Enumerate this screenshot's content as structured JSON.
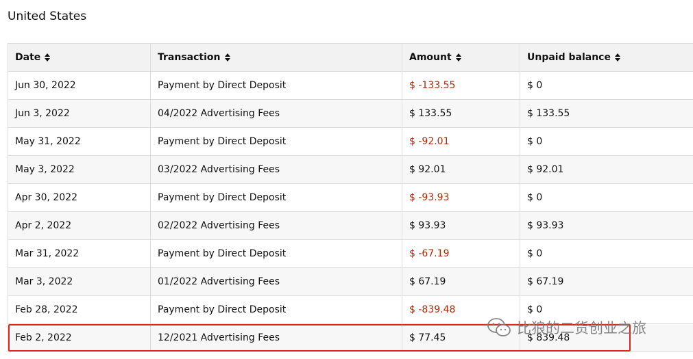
{
  "region_title": "United States",
  "columns": [
    "Date",
    "Transaction",
    "Amount",
    "Unpaid balance"
  ],
  "rows": [
    {
      "date": "Jun 30, 2022",
      "transaction": "Payment by Direct Deposit",
      "amount": "$ -133.55",
      "balance": "$ 0"
    },
    {
      "date": "Jun 3, 2022",
      "transaction": "04/2022 Advertising Fees",
      "amount": "$ 133.55",
      "balance": "$ 133.55"
    },
    {
      "date": "May 31, 2022",
      "transaction": "Payment by Direct Deposit",
      "amount": "$ -92.01",
      "balance": "$ 0"
    },
    {
      "date": "May 3, 2022",
      "transaction": "03/2022 Advertising Fees",
      "amount": "$ 92.01",
      "balance": "$ 92.01"
    },
    {
      "date": "Apr 30, 2022",
      "transaction": "Payment by Direct Deposit",
      "amount": "$ -93.93",
      "balance": "$ 0"
    },
    {
      "date": "Apr 2, 2022",
      "transaction": "02/2022 Advertising Fees",
      "amount": "$ 93.93",
      "balance": "$ 93.93"
    },
    {
      "date": "Mar 31, 2022",
      "transaction": "Payment by Direct Deposit",
      "amount": "$ -67.19",
      "balance": "$ 0"
    },
    {
      "date": "Mar 3, 2022",
      "transaction": "01/2022 Advertising Fees",
      "amount": "$ 67.19",
      "balance": "$ 67.19"
    },
    {
      "date": "Feb 28, 2022",
      "transaction": "Payment by Direct Deposit",
      "amount": "$ -839.48",
      "balance": "$ 0"
    },
    {
      "date": "Feb 2, 2022",
      "transaction": "12/2021 Advertising Fees",
      "amount": "$ 77.45",
      "balance": "$ 839.48"
    }
  ],
  "negative_color": "#b12704",
  "highlight_color": "#e3241b",
  "watermark": {
    "icon": "wechat-icon",
    "text": "比狼的二货创业之旅"
  }
}
